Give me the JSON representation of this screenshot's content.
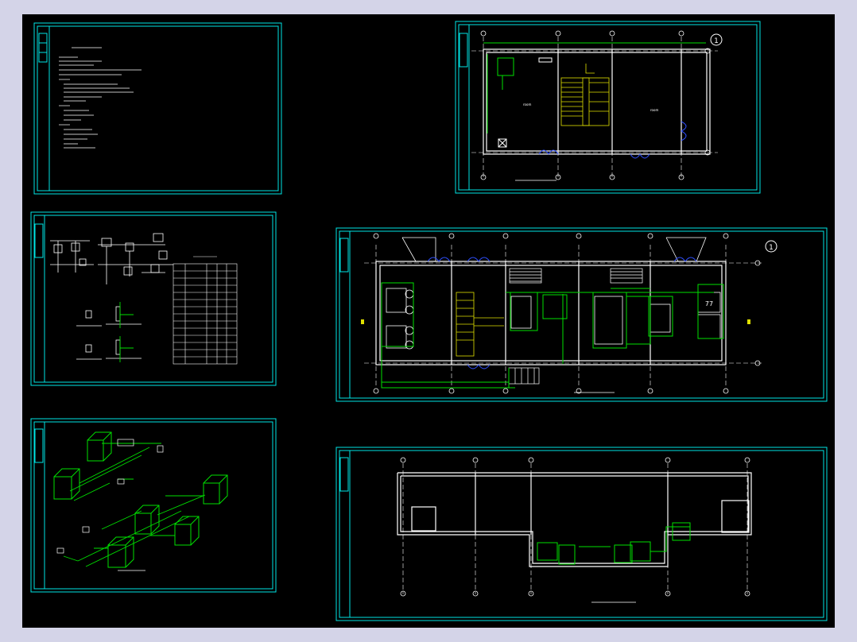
{
  "viewport": {
    "background": "#d4d4e8",
    "canvas_color": "#000000"
  },
  "colors": {
    "frame": "#00e5e5",
    "line": "#ffffff",
    "pipe": "#00e000",
    "stair": "#e0e000",
    "door": "#3050ff"
  },
  "sheets": [
    {
      "id": "design-notes",
      "kind": "notes"
    },
    {
      "id": "upper-floor-plan",
      "kind": "plan",
      "grid_marker": "1"
    },
    {
      "id": "system-schematic",
      "kind": "schematic"
    },
    {
      "id": "ground-floor-plan",
      "kind": "plan",
      "grid_marker": "1"
    },
    {
      "id": "isometric-view",
      "kind": "isometric"
    },
    {
      "id": "roof-plan",
      "kind": "plan"
    }
  ],
  "tank_label": "77"
}
